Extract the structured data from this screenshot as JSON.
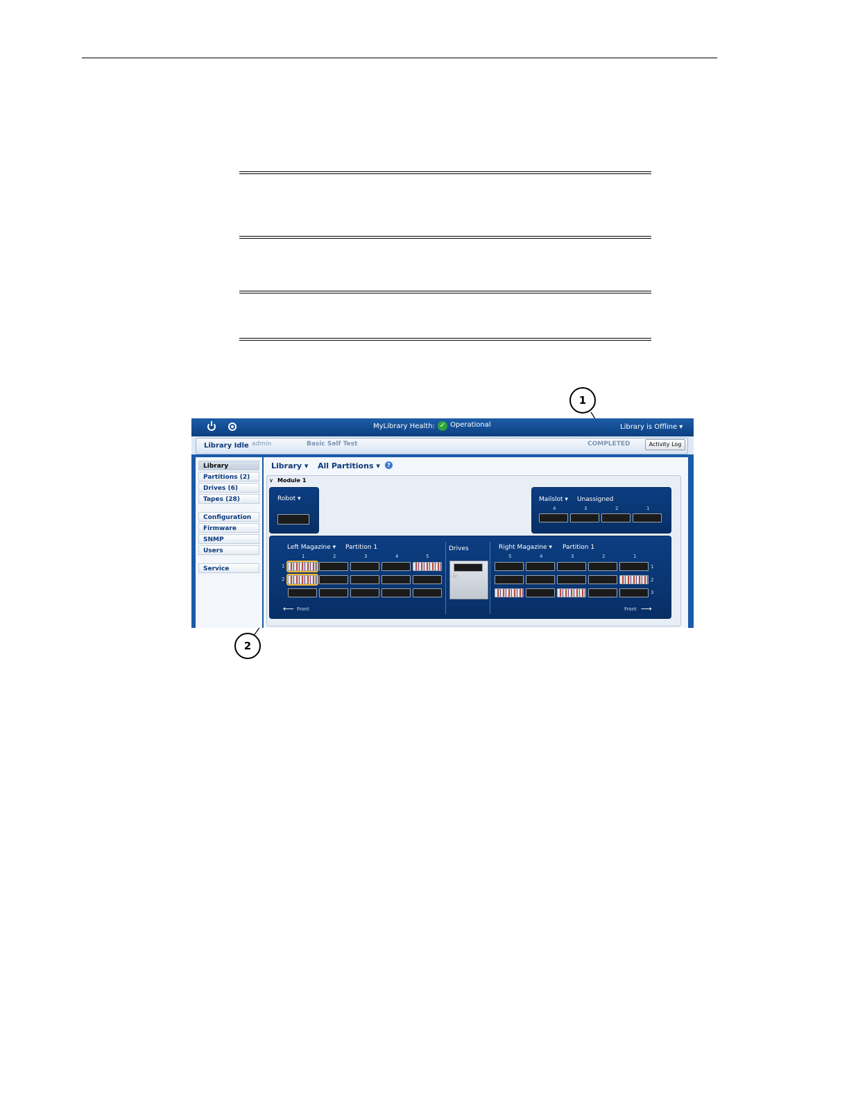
{
  "callouts": {
    "one": "1",
    "two": "2"
  },
  "topbar": {
    "health_label": "MyLibrary Health:",
    "health_status": "Operational",
    "library_status": "Library is Offline ▾"
  },
  "statusbar": {
    "state": "Library Idle",
    "user": "admin",
    "operation": "Basic Self Test",
    "result": "COMPLETED",
    "activity_log": "Activity Log"
  },
  "sidebar": {
    "items": [
      "Library",
      "Partitions (2)",
      "Drives (6)",
      "Tapes (28)"
    ],
    "items2": [
      "Configuration",
      "Firmware",
      "SNMP",
      "Users"
    ],
    "service": "Service"
  },
  "toolbar": {
    "library": "Library ▾",
    "partitions": "All Partitions ▾",
    "help": "?"
  },
  "module": {
    "title": "Module 1",
    "robot": "Robot ▾",
    "mailslot": "Mailslot ▾",
    "mailslot_assignment": "Unassigned",
    "mailslot_cols": [
      "4",
      "3",
      "2",
      "1"
    ],
    "left_magazine": "Left Magazine ▾",
    "left_partition": "Partition 1",
    "left_cols": [
      "1",
      "2",
      "3",
      "4",
      "5"
    ],
    "left_rows": [
      "1",
      "2"
    ],
    "drives": "Drives",
    "right_magazine": "Right Magazine ▾",
    "right_partition": "Partition 1",
    "right_cols": [
      "5",
      "4",
      "3",
      "2",
      "1"
    ],
    "right_rows": [
      "1",
      "2",
      "3"
    ],
    "front_left": "Front",
    "front_right": "Front"
  },
  "colors": {
    "header_blue": "#1d5da8",
    "panel_blue": "#0c3e82",
    "selected": "#f2b22a",
    "ok_green": "#2ea33c"
  }
}
